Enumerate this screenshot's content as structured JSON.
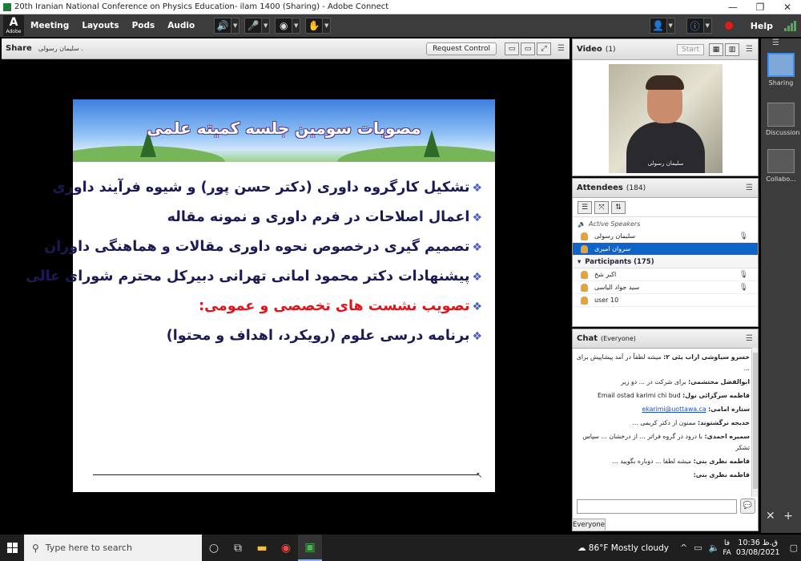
{
  "window": {
    "title": "20th Iranian National Conference on Physics Education- ilam 1400 (Sharing) - Adobe Connect",
    "minimize": "—",
    "maximize": "❐",
    "close": "✕"
  },
  "menubar": {
    "logo": "A",
    "logo_sub": "Adobe",
    "items": [
      "Meeting",
      "Layouts",
      "Pods",
      "Audio"
    ],
    "help": "Help"
  },
  "share": {
    "title": "Share",
    "presenter": "سلیمان رسولی .",
    "request_control": "Request Control"
  },
  "slide": {
    "title": "مصوبات سومین جلسه کمیته علمی",
    "bullets": [
      {
        "text": "تشکیل کارگروه داوری (دکتر حسن پور) و شیوه فرآیند داوری",
        "red": false
      },
      {
        "text": "اعمال اصلاحات در فرم داوری و نمونه مقاله",
        "red": false
      },
      {
        "text": "تصمیم گیری درخصوص نحوه داوری مقالات و هماهنگی داوران",
        "red": false
      },
      {
        "text": "پیشنهادات دکتر محمود امانی تهرانی دبیرکل محترم شورای عالی",
        "red": false
      },
      {
        "text": "تصویب نشست های تخصصی و عمومی:",
        "red": true
      },
      {
        "text": "برنامه درسی علوم (رویکرد، اهداف و محتوا)",
        "red": false
      }
    ]
  },
  "video": {
    "title": "Video",
    "count": "(1)",
    "start_label": "Start",
    "caption": "سلیمان رسولی"
  },
  "attendees": {
    "title": "Attendees",
    "count": "(184)",
    "active_speakers_label": "Active Speakers",
    "active_speakers": [
      {
        "name": "سلیمان رسولی",
        "selected": false
      },
      {
        "name": "سروان امیری",
        "selected": true
      }
    ],
    "participants_label": "Participants (175)",
    "participants": [
      "اکبر شخ",
      "سید جواد الیاسی",
      "user 10"
    ]
  },
  "chat": {
    "title": "Chat",
    "scope": "(Everyone)",
    "messages": [
      {
        "sender": "خسرو سیاوشی اراب یئی ۲:",
        "text": "میشه لطفاً در آمد پیشاپیش برای ..."
      },
      {
        "sender": "ابوالفضل محتشمی:",
        "text": "برای شرکت در ... دو زیر"
      },
      {
        "sender": "فاطمه سرگزائی نول:",
        "text": "Email ostad karimi chi bud"
      },
      {
        "sender": "ستاره امامی:",
        "text": "ekarimi@uottawa.ca",
        "link": true
      },
      {
        "sender": "خدیجه نرگشتوند:",
        "text": "ممنون از دکتر کریمی ..."
      },
      {
        "sender": "سمیره احمدی:",
        "text": "با درود در گروه فراتر ... از درخشان ... سپاس تشکر"
      },
      {
        "sender": "فاطمه نظری بنی:",
        "text": "میشه لطفا ... دوباره بگویید ..."
      },
      {
        "sender": "فاطمه نظری بنی:",
        "text": ""
      }
    ],
    "tab": "Everyone",
    "send_icon": "speech-bubble-icon"
  },
  "layouts": {
    "items": [
      {
        "label": "Sharing",
        "active": true
      },
      {
        "label": "Discussion",
        "active": false
      },
      {
        "label": "Collabo...",
        "active": false
      }
    ]
  },
  "taskbar": {
    "search_placeholder": "Type here to search",
    "weather": "86°F  Mostly cloudy",
    "time": "10:36 ق.ظ",
    "date": "03/08/2021",
    "lang_top": "فا",
    "lang_bottom": "FA"
  }
}
